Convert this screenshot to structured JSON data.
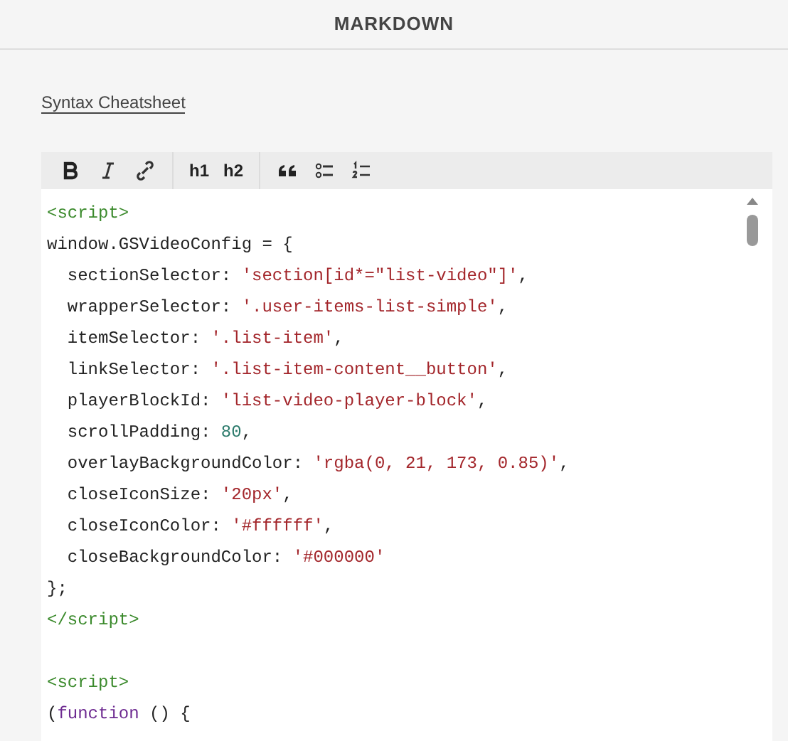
{
  "header": {
    "title": "MARKDOWN"
  },
  "link": "Syntax Cheatsheet",
  "toolbar": [
    {
      "kind": "bold"
    },
    {
      "kind": "italic"
    },
    {
      "kind": "link"
    },
    {
      "kind": "divider"
    },
    {
      "kind": "text",
      "label": "h1"
    },
    {
      "kind": "text",
      "label": "h2"
    },
    {
      "kind": "divider"
    },
    {
      "kind": "quote"
    },
    {
      "kind": "bullets"
    },
    {
      "kind": "numbers"
    }
  ],
  "code_blocks": [
    [
      [
        {
          "kind": "tag",
          "text": "<script>"
        }
      ],
      [
        {
          "kind": "plain",
          "text": "window.GSVideoConfig = {"
        }
      ],
      [
        {
          "kind": "plain",
          "text": "  sectionSelector: "
        },
        {
          "kind": "string",
          "text": "'section[id*=\"list-video\"]'"
        },
        {
          "kind": "plain",
          "text": ","
        }
      ],
      [
        {
          "kind": "plain",
          "text": "  wrapperSelector: "
        },
        {
          "kind": "string",
          "text": "'.user-items-list-simple'"
        },
        {
          "kind": "plain",
          "text": ","
        }
      ],
      [
        {
          "kind": "plain",
          "text": "  itemSelector: "
        },
        {
          "kind": "string",
          "text": "'.list-item'"
        },
        {
          "kind": "plain",
          "text": ","
        }
      ],
      [
        {
          "kind": "plain",
          "text": "  linkSelector: "
        },
        {
          "kind": "string",
          "text": "'.list-item-content__button'"
        },
        {
          "kind": "plain",
          "text": ","
        }
      ],
      [
        {
          "kind": "plain",
          "text": "  playerBlockId: "
        },
        {
          "kind": "string",
          "text": "'list-video-player-block'"
        },
        {
          "kind": "plain",
          "text": ","
        }
      ],
      [
        {
          "kind": "plain",
          "text": "  scrollPadding: "
        },
        {
          "kind": "number",
          "text": "80"
        },
        {
          "kind": "plain",
          "text": ","
        }
      ],
      [
        {
          "kind": "plain",
          "text": "  overlayBackgroundColor: "
        },
        {
          "kind": "string",
          "text": "'rgba(0, 21, 173, 0.85)'"
        },
        {
          "kind": "plain",
          "text": ","
        }
      ],
      [
        {
          "kind": "plain",
          "text": "  closeIconSize: "
        },
        {
          "kind": "string",
          "text": "'20px'"
        },
        {
          "kind": "plain",
          "text": ","
        }
      ],
      [
        {
          "kind": "plain",
          "text": "  closeIconColor: "
        },
        {
          "kind": "string",
          "text": "'#ffffff'"
        },
        {
          "kind": "plain",
          "text": ","
        }
      ],
      [
        {
          "kind": "plain",
          "text": "  closeBackgroundColor: "
        },
        {
          "kind": "string",
          "text": "'#000000'"
        }
      ],
      [
        {
          "kind": "plain",
          "text": "};"
        }
      ],
      [
        {
          "kind": "tag",
          "text": "</script>"
        }
      ]
    ],
    [
      [
        {
          "kind": "tag",
          "text": "<script>"
        }
      ],
      [
        {
          "kind": "plain",
          "text": "("
        },
        {
          "kind": "keyword",
          "text": "function"
        },
        {
          "kind": "plain",
          "text": " () {"
        }
      ]
    ]
  ]
}
